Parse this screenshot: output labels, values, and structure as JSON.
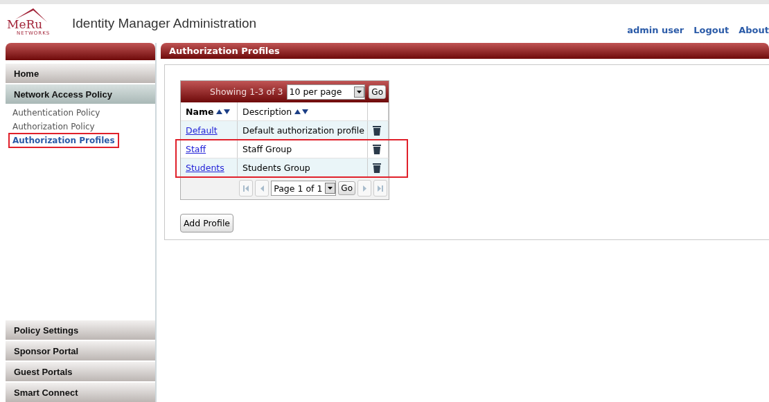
{
  "header": {
    "logo": {
      "name": "MeRu",
      "sub": "NETWORKS"
    },
    "title": "Identity Manager Administration",
    "links": [
      "admin user",
      "Logout",
      "About"
    ]
  },
  "sidebar": {
    "sections": [
      {
        "label": "Home",
        "selected": false
      },
      {
        "label": "Network Access Policy",
        "selected": true,
        "children": [
          {
            "label": "Authentication Policy",
            "selected": false,
            "highlighted": false
          },
          {
            "label": "Authorization Policy",
            "selected": false,
            "highlighted": false
          },
          {
            "label": "Authorization Profiles",
            "selected": true,
            "highlighted": true
          }
        ]
      }
    ],
    "bottom_sections": [
      "Policy Settings",
      "Sponsor Portal",
      "Guest Portals",
      "Smart Connect"
    ]
  },
  "panel": {
    "title": "Authorization Profiles",
    "table": {
      "showing": "Showing 1-3 of 3",
      "per_page": "10 per page",
      "go": "Go",
      "columns": [
        "Name",
        "Description"
      ],
      "rows": [
        {
          "name": "Default",
          "description": "Default authorization profile",
          "highlighted": false
        },
        {
          "name": "Staff",
          "description": "Staff Group",
          "highlighted": true
        },
        {
          "name": "Students",
          "description": "Students Group",
          "highlighted": true
        }
      ],
      "pager": {
        "page": "Page 1 of 1",
        "go": "Go"
      }
    },
    "add_button": "Add Profile"
  }
}
